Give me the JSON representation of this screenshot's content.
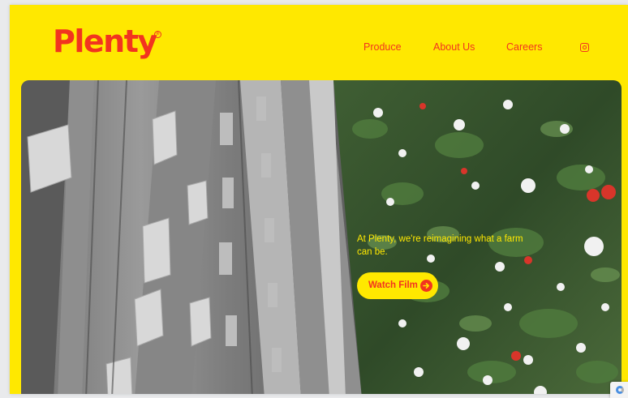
{
  "header": {
    "logo_text": "Plenty",
    "logo_mark": "®",
    "nav": {
      "produce": "Produce",
      "about": "About Us",
      "careers": "Careers"
    },
    "social_icon": "instagram-icon"
  },
  "hero": {
    "tagline": "At Plenty, we're reimagining what a farm can be.",
    "watch_label": "Watch Film",
    "watch_icon": "arrow-right-circle-icon"
  },
  "colors": {
    "brand_yellow": "#FFE800",
    "brand_red": "#F2341F"
  }
}
